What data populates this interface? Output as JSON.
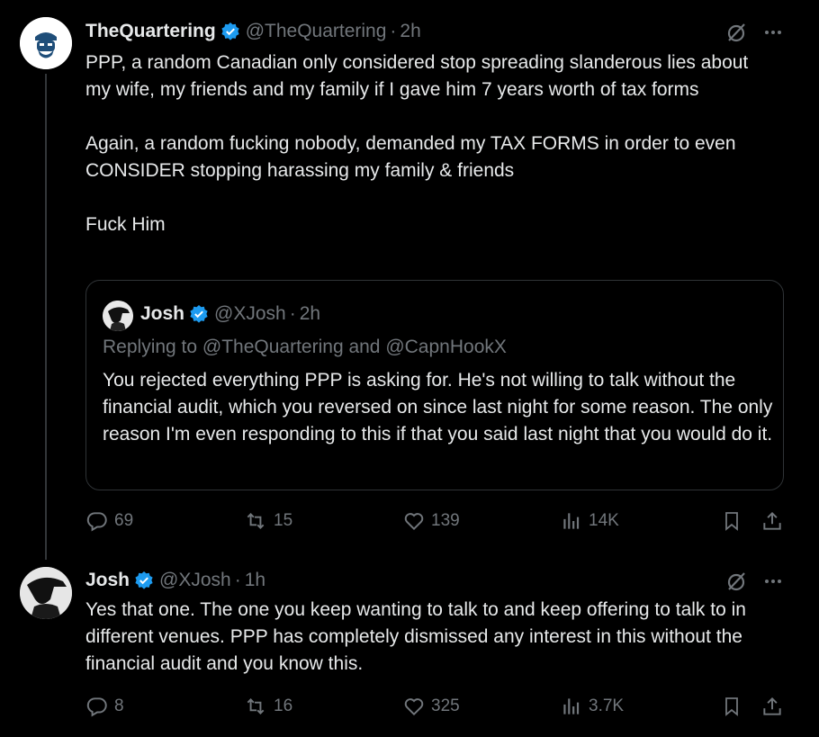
{
  "tweet1": {
    "author_name": "TheQuartering",
    "handle": "@TheQuartering",
    "dot": "·",
    "time": "2h",
    "body": [
      "PPP, a random Canadian only considered stop spreading slanderous lies about my wife, my friends and my family if I gave him 7 years worth of tax forms",
      "Again, a random fucking nobody, demanded my TAX FORMS in order to even CONSIDER stopping harassing my family & friends",
      "Fuck Him"
    ],
    "quote": {
      "author_name": "Josh",
      "handle": "@XJosh",
      "dot": "·",
      "time": "2h",
      "replying": "Replying to @TheQuartering and @CapnHookX",
      "text": "You rejected everything PPP is asking for. He's not willing to talk without the financial audit, which you reversed on since last night for some reason. The only reason I'm even responding to this if that you said last night that you would do it."
    },
    "stats": {
      "replies": "69",
      "reposts": "15",
      "likes": "139",
      "views": "14K"
    }
  },
  "tweet2": {
    "author_name": "Josh",
    "handle": "@XJosh",
    "dot": "·",
    "time": "1h",
    "body": "Yes that one. The one you keep wanting to talk to and keep offering to talk to in different venues. PPP has completely dismissed any interest in this without the financial audit and you know this.",
    "stats": {
      "replies": "8",
      "reposts": "16",
      "likes": "325",
      "views": "3.7K"
    }
  },
  "colors": {
    "background": "#000000",
    "text": "#e7e9ea",
    "muted": "#71767b",
    "verified": "#1d9bf0",
    "border": "#2f3336"
  },
  "icons": [
    "verified-badge-icon",
    "grok-icon",
    "more-icon",
    "reply-icon",
    "repost-icon",
    "like-icon",
    "views-icon",
    "bookmark-icon",
    "share-icon"
  ]
}
